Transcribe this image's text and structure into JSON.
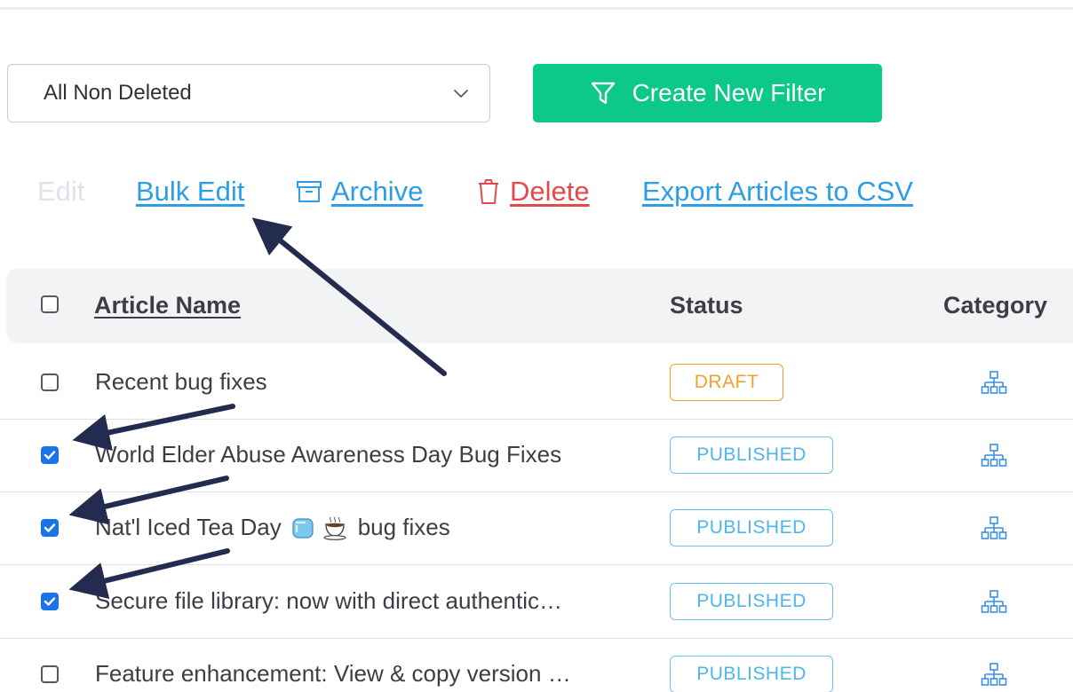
{
  "filter": {
    "selected": "All Non Deleted",
    "create_label": "Create New Filter"
  },
  "actions": {
    "edit": "Edit",
    "bulk_edit": "Bulk Edit",
    "archive": "Archive",
    "delete": "Delete",
    "export": "Export Articles to CSV"
  },
  "table": {
    "headers": {
      "name": "Article Name",
      "status": "Status",
      "category": "Category"
    },
    "rows": [
      {
        "title": "Recent bug fixes",
        "status": "DRAFT",
        "checked": false
      },
      {
        "title": "World Elder Abuse Awareness Day Bug Fixes",
        "status": "PUBLISHED",
        "checked": true
      },
      {
        "title_pre": "Nat'l Iced Tea Day",
        "title_post": "bug fixes",
        "status": "PUBLISHED",
        "checked": true
      },
      {
        "title": "Secure file library: now with direct authentic…",
        "status": "PUBLISHED",
        "checked": true
      },
      {
        "title": "Feature enhancement: View & copy version …",
        "status": "PUBLISHED",
        "checked": false
      }
    ]
  },
  "icons": {
    "filter": "funnel-icon",
    "archive": "archive-box-icon",
    "delete": "trash-icon",
    "category": "hierarchy-icon",
    "dropdown": "chevron-down-icon"
  },
  "colors": {
    "accent_green": "#0cc988",
    "link_blue": "#2d9ee6",
    "delete_red": "#e14b4b",
    "draft_orange": "#f2a12b",
    "published_blue": "#4fb6ea",
    "annotation_arrow": "#232b4f"
  }
}
